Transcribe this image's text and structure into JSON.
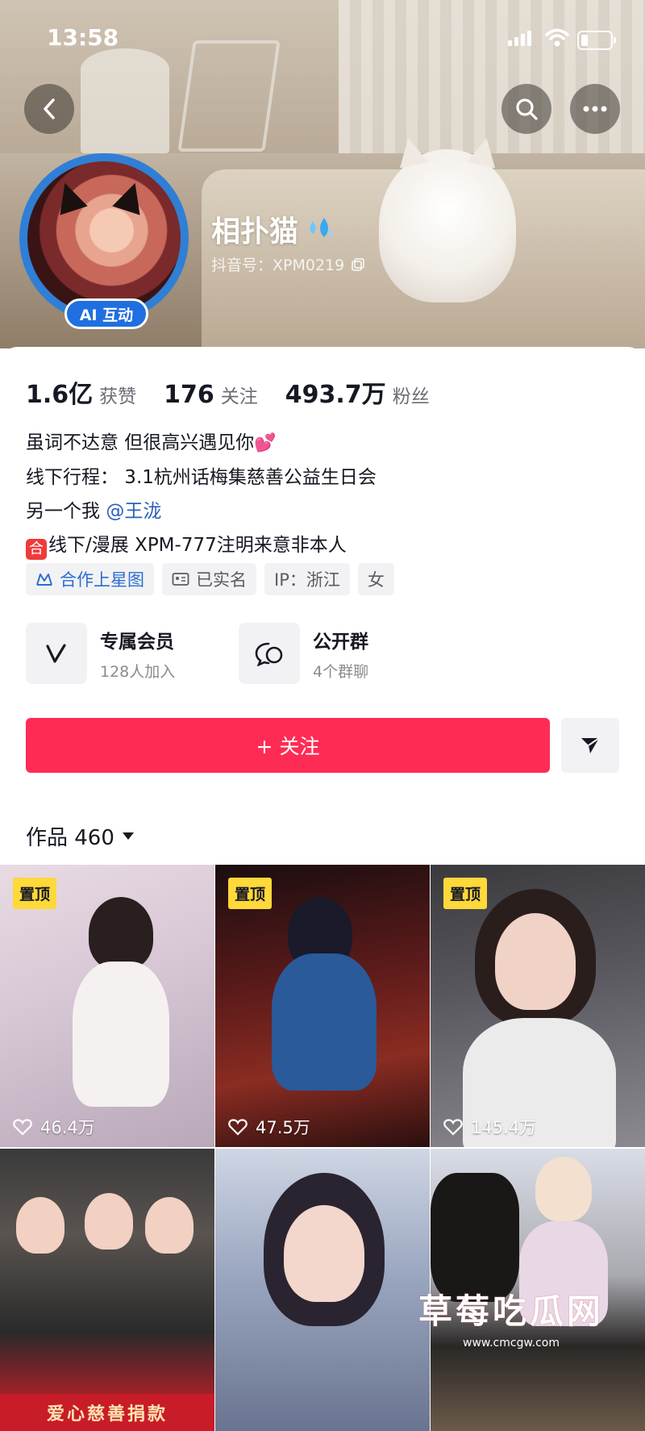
{
  "status_bar": {
    "time": "13:58"
  },
  "profile": {
    "nickname": "相扑猫",
    "douyin_id": "抖音号：XPM0219",
    "ai_badge": "AI 互动"
  },
  "stats": [
    {
      "value": "1.6亿",
      "label": "获赞"
    },
    {
      "value": "176",
      "label": "关注"
    },
    {
      "value": "493.7万",
      "label": "粉丝"
    }
  ],
  "bio": {
    "line1": "虽词不达意 但很高兴遇见你",
    "line2": "线下行程：  3.1杭州话梅集慈善公益生日会",
    "line3_prefix": "另一个我",
    "line3_mention": "@王泷",
    "line4_tag": "合",
    "line4": "线下/漫展 XPM-777注明来意非本人"
  },
  "tags": [
    {
      "label": "合作上星图",
      "icon": "starmap-icon"
    },
    {
      "label": "已实名",
      "icon": "id-card-icon"
    },
    {
      "label": "IP：浙江"
    },
    {
      "label": "女"
    }
  ],
  "features": [
    {
      "title": "专属会员",
      "subtitle": "128人加入",
      "icon": "membership-v-icon"
    },
    {
      "title": "公开群",
      "subtitle": "4个群聊",
      "icon": "group-chat-icon"
    }
  ],
  "follow_button": {
    "label": "+ 关注"
  },
  "works": {
    "label": "作品 460"
  },
  "videos": [
    {
      "pinned": "置顶",
      "likes": "46.4万"
    },
    {
      "pinned": "置顶",
      "likes": "47.5万"
    },
    {
      "pinned": "置顶",
      "likes": "145.4万"
    },
    {
      "caption": "爱心慈善捐款"
    },
    {},
    {}
  ],
  "watermark": {
    "title": "草莓吃瓜网",
    "url": "www.cmcgw.com"
  },
  "colors": {
    "accent": "#fe2c55",
    "avatar_ring": "#2f7fd6",
    "pin": "#ffd83a"
  }
}
